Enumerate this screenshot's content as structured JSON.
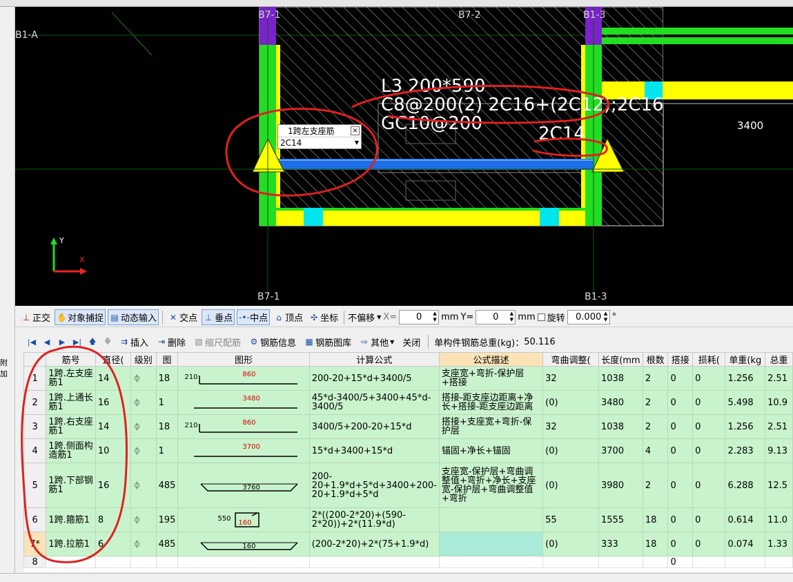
{
  "left_panel": {
    "label": "附加"
  },
  "canvas": {
    "axis_labels": {
      "b1a": "B1-A",
      "b7_1_top": "B7-1",
      "b7_2_top": "B7-2",
      "b1_3_top": "B1-3",
      "b7_1_bottom": "B7-1",
      "b1_3_bottom": "B1-3"
    },
    "beam_text": {
      "line1": "L3 200*590",
      "line2": "C8@200(2) 2C16+(2C12);2C16",
      "line3": "GC10@200",
      "line4": "2C14"
    },
    "dimension": "3400",
    "axis_y": "Y",
    "axis_x": "X"
  },
  "popup": {
    "title": "1跨左支座筋",
    "value": "2C14",
    "close": "×"
  },
  "snap_toolbar": {
    "ortho": "正交",
    "object_snap": "对象捕捉",
    "dynamic_input": "动态输入",
    "intersection": "交点",
    "perpendicular": "垂点",
    "midpoint": "中点",
    "vertex": "顶点",
    "coordinate": "坐标",
    "offset_mode": "不偏移",
    "x_label": "X=",
    "x_value": "0",
    "x_unit": "mm",
    "y_label": "Y=",
    "y_value": "0",
    "y_unit": "mm",
    "rotate_label": "旋转",
    "rotate_value": "0.000",
    "degree": "°"
  },
  "rebar_toolbar": {
    "insert": "插入",
    "delete": "删除",
    "scale_rebar": "缩尺配筋",
    "rebar_info": "钢筋信息",
    "rebar_library": "钢筋图库",
    "other": "其他",
    "close": "关闭",
    "total_weight_label": "单构件钢筋总重(kg)：",
    "total_weight": "50.116"
  },
  "table": {
    "headers": [
      "筋号",
      "直径(",
      "级别",
      "图",
      "图形",
      "计算公式",
      "公式描述",
      "弯曲调整(",
      "长度(mm",
      "根数",
      "搭接",
      "损耗(",
      "单重(kg",
      "总重"
    ],
    "rows": [
      {
        "no": "1",
        "name": "1跨.左支座筋1",
        "dia": "14",
        "grade": "⏀",
        "fig": "18",
        "shape": {
          "left": "210",
          "main": "860"
        },
        "formula": "200-20+15*d+3400/5",
        "desc": "支座宽+弯折-保护层+搭接",
        "bend": "32",
        "length": "1038",
        "count": "2",
        "lap": "0",
        "loss": "0",
        "unit_w": "1.256",
        "total_w": "2.51"
      },
      {
        "no": "2",
        "name": "1跨.上通长筋1",
        "dia": "16",
        "grade": "⏀",
        "fig": "1",
        "shape": {
          "left": "",
          "main": "3480"
        },
        "formula": "45*d-3400/5+3400+45*d-3400/5",
        "desc": "搭接-距支座边距离+净长+搭接-距支座边距离",
        "bend": "(0)",
        "length": "3480",
        "count": "2",
        "lap": "0",
        "loss": "0",
        "unit_w": "5.498",
        "total_w": "10.9"
      },
      {
        "no": "3",
        "name": "1跨.右支座筋1",
        "dia": "14",
        "grade": "⏀",
        "fig": "18",
        "shape": {
          "left": "210",
          "main": "860"
        },
        "formula": "3400/5+200-20+15*d",
        "desc": "搭接+支座宽+弯折-保护层",
        "bend": "32",
        "length": "1038",
        "count": "2",
        "lap": "0",
        "loss": "0",
        "unit_w": "1.256",
        "total_w": "2.51"
      },
      {
        "no": "4",
        "name": "1跨.侧面构造筋1",
        "dia": "10",
        "grade": "⏀",
        "fig": "1",
        "shape": {
          "left": "",
          "main": "3700"
        },
        "formula": "15*d+3400+15*d",
        "desc": "锚固+净长+锚固",
        "bend": "(0)",
        "length": "3700",
        "count": "4",
        "lap": "0",
        "loss": "0",
        "unit_w": "2.283",
        "total_w": "9.13"
      },
      {
        "no": "5",
        "name": "1跨.下部钢筋1",
        "dia": "16",
        "grade": "⏀",
        "fig": "485",
        "shape": {
          "left": "",
          "main": "3760"
        },
        "formula": "200-20+1.9*d+5*d+3400+200-20+1.9*d+5*d",
        "desc": "支座宽-保护层+弯曲调整值+弯折+净长+支座宽-保护层+弯曲调整值+弯折",
        "bend": "(0)",
        "length": "3980",
        "count": "2",
        "lap": "0",
        "loss": "0",
        "unit_w": "6.288",
        "total_w": "12.5"
      },
      {
        "no": "6",
        "name": "1跨.箍筋1",
        "dia": "8",
        "grade": "⏀",
        "fig": "195",
        "shape": {
          "left": "550",
          "main": "160"
        },
        "formula": "2*((200-2*20)+(590-2*20))+2*(11.9*d)",
        "desc": "",
        "bend": "55",
        "length": "1555",
        "count": "18",
        "lap": "0",
        "loss": "0",
        "unit_w": "0.614",
        "total_w": "11.0"
      },
      {
        "no": "7*",
        "name": "1跨.拉筋1",
        "dia": "6",
        "grade": "⏀",
        "fig": "485",
        "shape": {
          "left": "",
          "main": "160"
        },
        "formula": "(200-2*20)+2*(75+1.9*d)",
        "desc": "",
        "bend": "(0)",
        "length": "333",
        "count": "18",
        "lap": "0",
        "loss": "0",
        "unit_w": "0.074",
        "total_w": "1.33"
      },
      {
        "no": "8",
        "name": "",
        "dia": "",
        "grade": "",
        "fig": "",
        "shape": {
          "left": "",
          "main": ""
        },
        "formula": "",
        "desc": "",
        "bend": "",
        "length": "",
        "count": "",
        "lap": "0",
        "loss": "",
        "unit_w": "",
        "total_w": ""
      }
    ]
  }
}
